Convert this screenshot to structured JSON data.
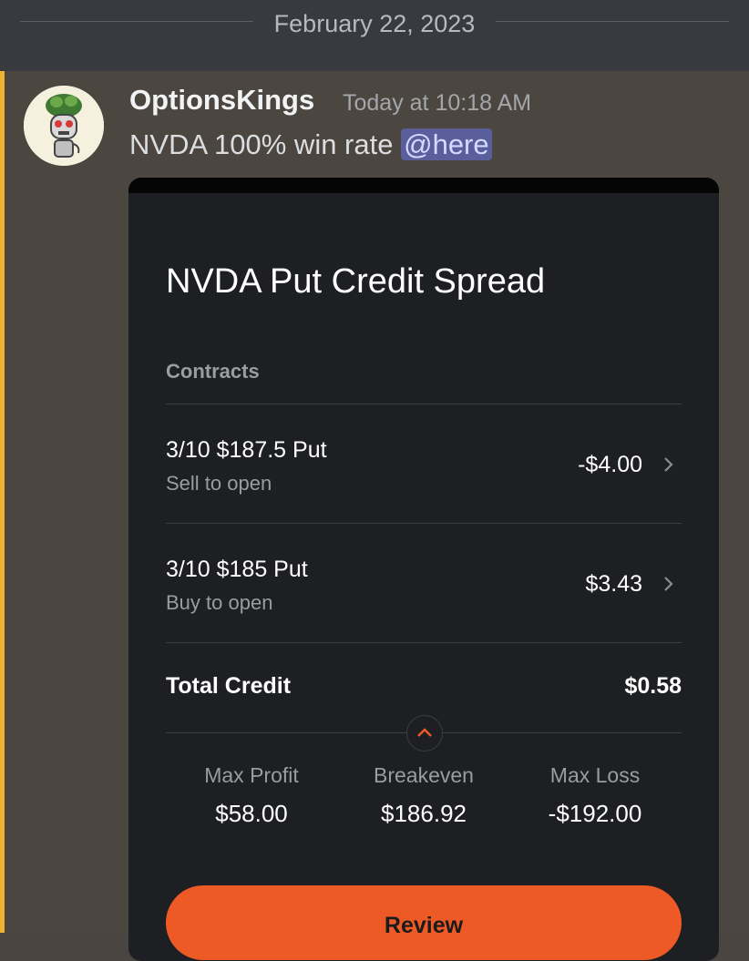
{
  "date_divider": {
    "label": "February 22, 2023"
  },
  "message": {
    "author": "OptionsKings",
    "timestamp": "Today at 10:18 AM",
    "text": "NVDA 100% win rate",
    "mention": "@here",
    "accent_color": "#f0b232"
  },
  "card": {
    "title": "NVDA Put Credit Spread",
    "contracts_label": "Contracts",
    "legs": [
      {
        "name": "3/10 $187.5 Put",
        "action": "Sell to open",
        "price": "-$4.00"
      },
      {
        "name": "3/10 $185 Put",
        "action": "Buy to open",
        "price": "$3.43"
      }
    ],
    "total_label": "Total Credit",
    "total_value": "$0.58",
    "stats": [
      {
        "label": "Max Profit",
        "value": "$58.00"
      },
      {
        "label": "Breakeven",
        "value": "$186.92"
      },
      {
        "label": "Max Loss",
        "value": "-$192.00"
      }
    ],
    "review_label": "Review",
    "accent_color": "#ee5a25"
  },
  "icons": {
    "chevron": "chevron-right-icon",
    "expand": "chevron-up-icon",
    "avatar": "avatar"
  }
}
